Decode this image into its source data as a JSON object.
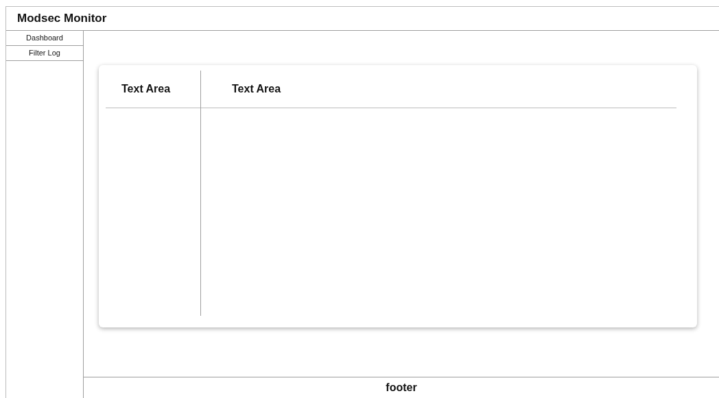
{
  "header": {
    "title": "Modsec Monitor"
  },
  "sidebar": {
    "items": [
      {
        "label": "Dashboard"
      },
      {
        "label": "Filter Log"
      }
    ]
  },
  "card": {
    "columns": [
      "Text Area",
      "Text Area"
    ]
  },
  "footer": {
    "text": "footer"
  }
}
